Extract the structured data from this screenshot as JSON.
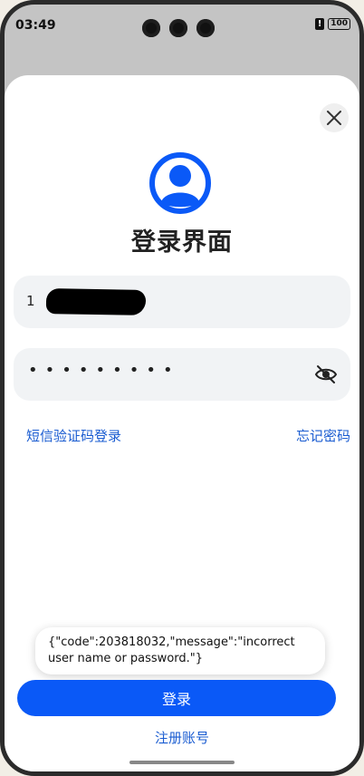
{
  "status_bar": {
    "time": "03:49",
    "alert_glyph": "!",
    "battery": "100"
  },
  "login": {
    "title": "登录界面",
    "username_value": "1",
    "password_mask": "•••••••••",
    "sms_login_label": "短信验证码登录",
    "forgot_password_label": "忘记密码",
    "login_button_label": "登录",
    "register_label": "注册账号"
  },
  "toast": {
    "message": "{\"code\":203818032,\"message\":\"incorrect user name or password.\"}"
  },
  "icons": {
    "close": "close-icon",
    "avatar": "user-avatar-icon",
    "eye": "eye-off-icon"
  },
  "colors": {
    "accent": "#0a59f7",
    "link": "#1a5cd1",
    "field_bg": "#f1f3f5"
  }
}
